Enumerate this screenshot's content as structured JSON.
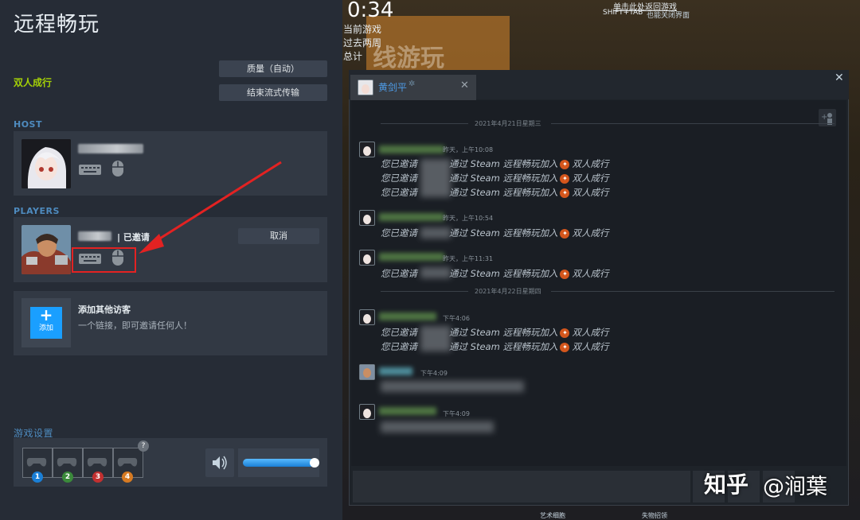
{
  "remote_play": {
    "title": "远程畅玩",
    "game_name": "双人成行",
    "quality_button": "质量（自动）",
    "stop_stream_button": "结束流式传输",
    "host_label": "HOST",
    "players_label": "PLAYERS",
    "invited_status": "| 已邀请",
    "cancel_button": "取消",
    "add_tile_label": "添加",
    "add_title": "添加其他访客",
    "add_desc": "一个链接，即可邀请任何人！",
    "settings_label": "游戏设置",
    "help_badge": "?",
    "controller_numbers": [
      "1",
      "2",
      "3",
      "4"
    ],
    "volume_level": 0.95
  },
  "overlay": {
    "clock": "0:34",
    "current_game_label": "当前游戏",
    "past_two_weeks_label": "过去两周",
    "total_label": "总计",
    "return_link": "单击此处返回游戏",
    "shift_tab_hint": "SHIFT+TAB",
    "shift_tab_suffix": "也能关闭界面",
    "banner_text": "线游玩",
    "footer_left": "艺术细胞",
    "footer_right": "失物招领"
  },
  "chat": {
    "tab_name": "黄剑平",
    "tab_close": "✕",
    "window_close": "✕",
    "date1": "2021年4月21日星期三",
    "date2": "2021年4月22日星期四",
    "messages": [
      {
        "time": "昨天，上午10:08",
        "lines": [
          "您已邀请",
          "通过 Steam 远程畅玩加入",
          "双人成行"
        ]
      },
      {
        "time": "昨天，上午10:54"
      },
      {
        "time": "昨天，上午11:31"
      },
      {
        "time": "下午4:06"
      },
      {
        "time": "下午4:09"
      },
      {
        "time": "下午4:09"
      }
    ],
    "invite_prefix": "您已邀请",
    "invite_mid": "通过 Steam 远程畅玩加入",
    "invite_game": "双人成行"
  },
  "watermark": {
    "brand": "知乎",
    "user": "@涧葉"
  },
  "colors": {
    "accent_blue": "#1a9fff",
    "game_green": "#a4d007",
    "highlight_red": "#e32222"
  }
}
